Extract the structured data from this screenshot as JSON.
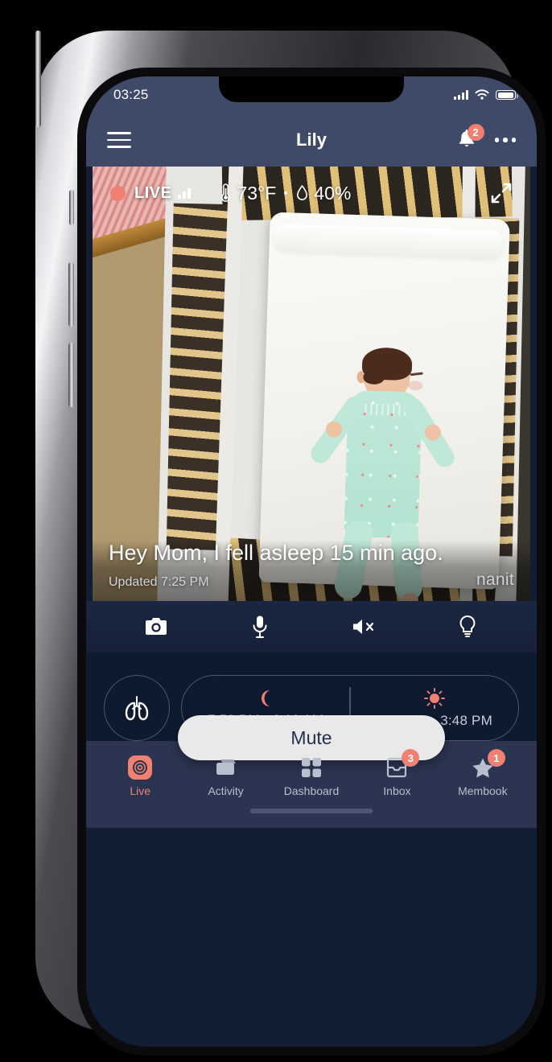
{
  "status_bar": {
    "time": "03:25",
    "signal_icon": "cellular-signal-icon",
    "wifi_icon": "wifi-icon",
    "battery_icon": "battery-icon"
  },
  "nav": {
    "menu_icon": "hamburger-menu-icon",
    "title": "Lily",
    "bell_icon": "bell-icon",
    "bell_badge": "2",
    "more_icon": "more-options-icon"
  },
  "video": {
    "live_label": "LIVE",
    "signal_icon": "signal-strength-icon",
    "temperature": "73°F",
    "temperature_icon": "thermometer-icon",
    "humidity": "40%",
    "humidity_icon": "humidity-droplet-icon",
    "expand_icon": "fullscreen-expand-icon",
    "message": "Hey Mom, I fell asleep 15 min ago.",
    "updated": "Updated 7:25 PM",
    "brand": "nanit"
  },
  "controls": [
    {
      "name": "camera-snapshot-button",
      "icon": "camera-icon"
    },
    {
      "name": "microphone-button",
      "icon": "microphone-icon"
    },
    {
      "name": "speaker-mute-button",
      "icon": "speaker-muted-icon"
    },
    {
      "name": "night-light-button",
      "icon": "lightbulb-icon"
    }
  ],
  "schedule": {
    "breathing_icon": "lungs-breathing-icon",
    "night": {
      "icon": "moon-icon",
      "time": "7:58 PM - 6:12 AM"
    },
    "day": {
      "icon": "sun-icon",
      "time": "9:00 AM - 3:48 PM"
    }
  },
  "toast": {
    "label": "Mute"
  },
  "tabs": [
    {
      "label": "Live",
      "icon": "live-target-icon",
      "badge": "",
      "active": true
    },
    {
      "label": "Activity",
      "icon": "activity-folder-icon",
      "badge": "",
      "active": false
    },
    {
      "label": "Dashboard",
      "icon": "dashboard-grid-icon",
      "badge": "",
      "active": false
    },
    {
      "label": "Inbox",
      "icon": "inbox-tray-icon",
      "badge": "3",
      "active": false
    },
    {
      "label": "Membook",
      "icon": "star-icon",
      "badge": "1",
      "active": false
    }
  ],
  "colors": {
    "accent": "#f08072",
    "header_bg": "#3e4a68",
    "app_bg": "#0e1a30",
    "tabbar_bg": "#2b3450",
    "toast_bg": "#e9e9ea"
  }
}
